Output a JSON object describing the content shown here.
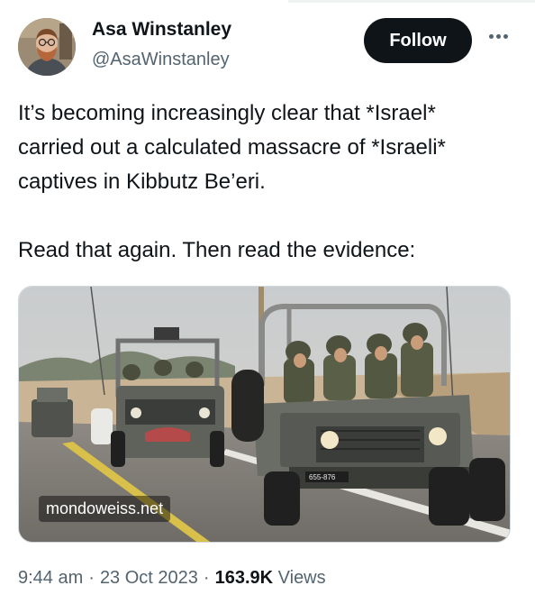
{
  "author": {
    "name": "Asa Winstanley",
    "handle": "@AsaWinstanley"
  },
  "actions": {
    "follow_label": "Follow",
    "more_icon": "more-horizontal-icon"
  },
  "tweet": {
    "text": "It’s becoming increasingly clear that *Israel*\ncarried out a calculated massacre of *Israeli*\ncaptives in Kibbutz Be’eri.\n\nRead that again. Then read the evidence:"
  },
  "media": {
    "watermark": "mondoweiss.net",
    "plate": "655-876"
  },
  "meta": {
    "time": "9:44 am",
    "date": "23 Oct 2023",
    "views_count": "163.9K",
    "views_label": "Views",
    "separator": "·"
  },
  "colors": {
    "text": "#0f1419",
    "secondary": "#536471",
    "button_bg": "#0f1419"
  }
}
